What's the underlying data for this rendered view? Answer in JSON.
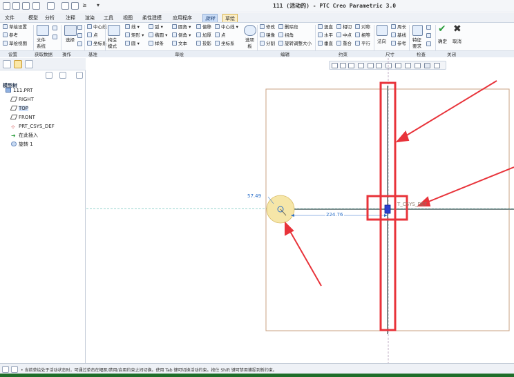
{
  "title": "111 (活动的) - PTC Creo Parametric 3.0",
  "quick_access": {
    "extra_symbols": [
      "≥",
      "▾"
    ]
  },
  "menu": {
    "tabs": [
      "文件",
      "模型",
      "分析",
      "注释",
      "渲染",
      "工具",
      "视图",
      "柔性建模",
      "应用程序",
      "旋转",
      "草绘"
    ]
  },
  "ribbon": {
    "setup": {
      "sketch_setup": "草绘设置",
      "references": "参考",
      "sketch_view": "草绘视图",
      "group": "设置"
    },
    "get_data": {
      "file_system": "文件\n系统",
      "group": "获取数据"
    },
    "operations": {
      "select": "选择",
      "group": "操作"
    },
    "datum": {
      "centerline": "中心线",
      "point": "点",
      "csys": "坐标系",
      "group": "基准"
    },
    "sketch": {
      "construction_mode": "构造\n模式",
      "line": "线",
      "arc": "弧",
      "fillet": "圆角",
      "offset": "偏移",
      "centerline": "中心线",
      "rectangle": "矩形",
      "ellipse": "椭圆",
      "chamfer": "倒角",
      "thicken": "加厚",
      "point": "点",
      "circle": "圆",
      "spline": "样条",
      "text": "文本",
      "project": "投影",
      "csys": "坐标系",
      "palette": "选项\n板",
      "group": "草绘"
    },
    "editing": {
      "modify": "修改",
      "delete_segment": "删除段",
      "mirror": "镜像",
      "corner": "拐角",
      "divide": "分割",
      "rotate_resize": "旋转调整大小",
      "group": "编辑"
    },
    "constrain": {
      "vertical": "竖直",
      "tangent": "相切",
      "symmetric": "对称",
      "horizontal": "水平",
      "midpoint": "中点",
      "equal": "相等",
      "perpendicular": "垂直",
      "coincident": "重合",
      "parallel": "平行",
      "group": "约束"
    },
    "dimension": {
      "normal": "法向",
      "perimeter": "周长",
      "baseline": "基线",
      "reference": "参考",
      "group": "尺寸"
    },
    "inspect": {
      "feature_reqs": "特征\n要求",
      "group": "检查"
    },
    "close": {
      "ok": "确定",
      "cancel": "取消",
      "group": "关闭"
    }
  },
  "model_tree": {
    "header": "模型树",
    "items": [
      {
        "label": "111.PRT",
        "icon": "part-icon"
      },
      {
        "label": "RIGHT",
        "icon": "plane-icon"
      },
      {
        "label": "TOP",
        "icon": "plane-icon",
        "selected": true
      },
      {
        "label": "FRONT",
        "icon": "plane-icon"
      },
      {
        "label": "PRT_CSYS_DEF",
        "icon": "csys-icon"
      },
      {
        "label": "在此插入",
        "icon": "insert-arrow-icon"
      },
      {
        "label": "旋转 1",
        "icon": "revolve-icon"
      }
    ]
  },
  "canvas": {
    "dim_diameter": "57.49",
    "dim_distance": "224.76",
    "csys_label": "T_CSYS_DEF"
  },
  "status": {
    "message": "• 当前草绘处于活动状态时，可通过单击在幅距/禁用/启用约束之间切换。使用 Tab 键可切换活动约束。按住 Shift 键可禁用捕捉到新约束。"
  },
  "colors": {
    "annotation_red": "#e8333a",
    "dimension_blue": "#2a6fc9",
    "highlight_circle": "#f6e6a8",
    "sketch_boundary": "#c8a080"
  }
}
